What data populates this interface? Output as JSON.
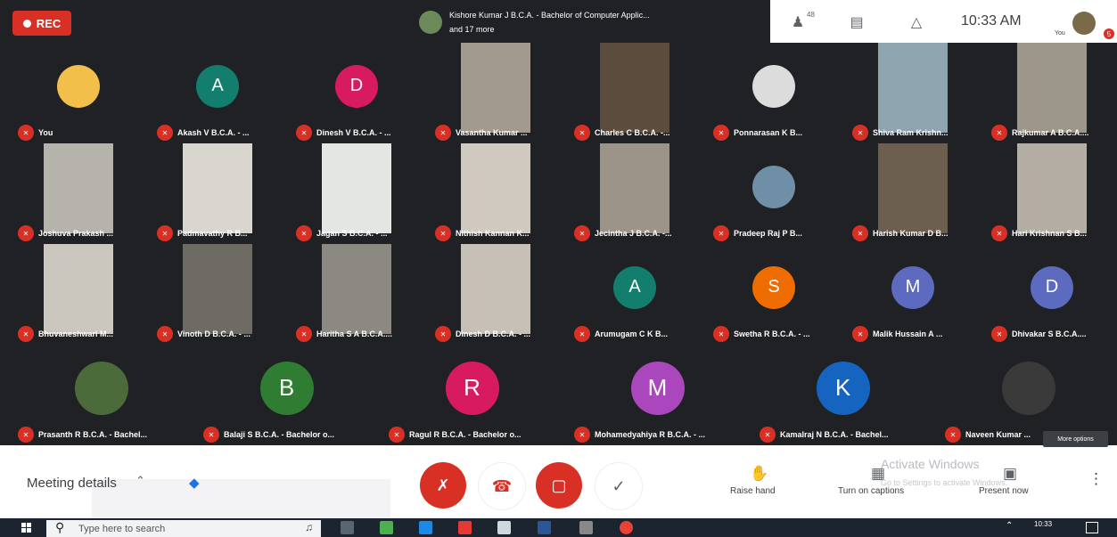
{
  "recording": {
    "label": "REC"
  },
  "presenter": {
    "line1": "Kishore Kumar J B.C.A. - Bachelor of Computer Applic...",
    "line2": "and 17 more"
  },
  "header": {
    "participant_count": "48",
    "time": "10:33 AM",
    "you_label": "You",
    "notification_count": "5"
  },
  "participants": [
    {
      "name": "You",
      "kind": "photo",
      "color": "#f2c04a"
    },
    {
      "name": "Akash V B.C.A. - ...",
      "kind": "initial",
      "initial": "A",
      "color": "#137e6e"
    },
    {
      "name": "Dinesh V B.C.A. - ...",
      "kind": "initial",
      "initial": "D",
      "color": "#d81b60"
    },
    {
      "name": "Vasantha Kumar ...",
      "kind": "video",
      "color": "#a29a8d"
    },
    {
      "name": "Charles C B.C.A. -...",
      "kind": "video",
      "color": "#5b4c3d"
    },
    {
      "name": "Ponnarasan K B...",
      "kind": "photo",
      "color": "#dcdcdc"
    },
    {
      "name": "Shiva Ram Krishn...",
      "kind": "video",
      "color": "#8ea5b0"
    },
    {
      "name": "Rajkumar A B.C.A....",
      "kind": "video",
      "color": "#9c968b"
    },
    {
      "name": "Joshuva Prakash ...",
      "kind": "video",
      "color": "#b6b2ac"
    },
    {
      "name": "Padmavathy R B...",
      "kind": "video",
      "color": "#d9d6d0"
    },
    {
      "name": "Jagan S B.C.A. - ...",
      "kind": "video",
      "color": "#e4e6e3"
    },
    {
      "name": "Nithish Kannan K...",
      "kind": "video",
      "color": "#cfc9c0"
    },
    {
      "name": "Jecintha J B.C.A. -...",
      "kind": "video",
      "color": "#9c9389"
    },
    {
      "name": "Pradeep Raj P B...",
      "kind": "photo",
      "color": "#6e8fa5"
    },
    {
      "name": "Harish Kumar D B...",
      "kind": "video",
      "color": "#6c5f4f"
    },
    {
      "name": "Hari Krishnan S B...",
      "kind": "video",
      "color": "#b3ada4"
    },
    {
      "name": "Bhuvaneshwari M...",
      "kind": "video",
      "color": "#cbc7bf"
    },
    {
      "name": "Vinoth D B.C.A. - ...",
      "kind": "video",
      "color": "#6e6a64"
    },
    {
      "name": "Haritha S A B.C.A....",
      "kind": "video",
      "color": "#8c8882"
    },
    {
      "name": "Dinesh D B.C.A. - ...",
      "kind": "video",
      "color": "#c6c0b6"
    },
    {
      "name": "Arumugam C K B...",
      "kind": "initial",
      "initial": "A",
      "color": "#137e6e"
    },
    {
      "name": "Swetha R B.C.A. - ...",
      "kind": "initial",
      "initial": "S",
      "color": "#ef6c00"
    },
    {
      "name": "Malik Hussain A ...",
      "kind": "initial",
      "initial": "M",
      "color": "#5c6bc0"
    },
    {
      "name": "Dhivakar S B.C.A....",
      "kind": "initial",
      "initial": "D",
      "color": "#5c6bc0"
    },
    {
      "name": "Prasanth R B.C.A. - Bachel...",
      "kind": "photo",
      "color": "#4b6b3a"
    },
    {
      "name": "Balaji S B.C.A. - Bachelor o...",
      "kind": "initial",
      "initial": "B",
      "color": "#2e7d32"
    },
    {
      "name": "Ragul R B.C.A. - Bachelor o...",
      "kind": "initial",
      "initial": "R",
      "color": "#d81b60"
    },
    {
      "name": "Mohamedyahiya R B.C.A. - ...",
      "kind": "initial",
      "initial": "M",
      "color": "#ab47bc"
    },
    {
      "name": "Kamalraj N B.C.A. - Bachel...",
      "kind": "initial",
      "initial": "K",
      "color": "#1565c0"
    },
    {
      "name": "Naveen Kumar ...",
      "kind": "photo",
      "color": "#3a3a3a"
    }
  ],
  "footer": {
    "meeting_details": "Meeting details",
    "raise_hand": "Raise hand",
    "captions": "Turn on captions",
    "present": "Present now",
    "more_options_tooltip": "More options",
    "activate_title": "Activate Windows",
    "activate_sub": "Go to Settings to activate Windows."
  },
  "taskbar": {
    "search_placeholder": "Type here to search",
    "time": "10:33"
  },
  "colors": {
    "dark_bg": "#202124",
    "muted_red": "#d93025",
    "accent_blue": "#1a73e8"
  }
}
